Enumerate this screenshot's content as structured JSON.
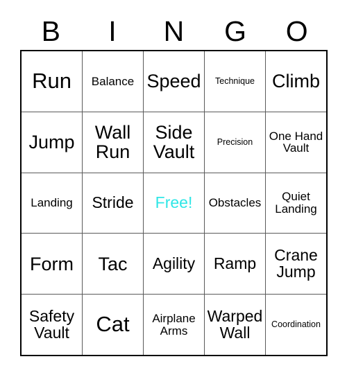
{
  "card": {
    "header_letters": [
      "B",
      "I",
      "N",
      "G",
      "O"
    ],
    "free_space_color": "#2fe6e6",
    "text_color": "#000000",
    "border_color": "#000000",
    "gridline_color": "#5a5a5a",
    "rows": [
      [
        {
          "text": "Run",
          "size": "sz-xl",
          "free": false
        },
        {
          "text": "Balance",
          "size": "sz-sm",
          "free": false
        },
        {
          "text": "Speed",
          "size": "sz-lg",
          "free": false
        },
        {
          "text": "Technique",
          "size": "sz-xs",
          "free": false
        },
        {
          "text": "Climb",
          "size": "sz-lg",
          "free": false
        }
      ],
      [
        {
          "text": "Jump",
          "size": "sz-lg",
          "free": false
        },
        {
          "text": "Wall Run",
          "size": "sz-lg",
          "free": false
        },
        {
          "text": "Side Vault",
          "size": "sz-lg",
          "free": false
        },
        {
          "text": "Precision",
          "size": "sz-xs",
          "free": false
        },
        {
          "text": "One Hand Vault",
          "size": "sz-sm",
          "free": false
        }
      ],
      [
        {
          "text": "Landing",
          "size": "sz-sm",
          "free": false
        },
        {
          "text": "Stride",
          "size": "sz-md",
          "free": false
        },
        {
          "text": "Free!",
          "size": "sz-md",
          "free": true
        },
        {
          "text": "Obstacles",
          "size": "sz-sm",
          "free": false
        },
        {
          "text": "Quiet Landing",
          "size": "sz-sm",
          "free": false
        }
      ],
      [
        {
          "text": "Form",
          "size": "sz-lg",
          "free": false
        },
        {
          "text": "Tac",
          "size": "sz-lg",
          "free": false
        },
        {
          "text": "Agility",
          "size": "sz-md",
          "free": false
        },
        {
          "text": "Ramp",
          "size": "sz-md",
          "free": false
        },
        {
          "text": "Crane Jump",
          "size": "sz-md",
          "free": false
        }
      ],
      [
        {
          "text": "Safety Vault",
          "size": "sz-md",
          "free": false
        },
        {
          "text": "Cat",
          "size": "sz-xl",
          "free": false
        },
        {
          "text": "Airplane Arms",
          "size": "sz-sm",
          "free": false
        },
        {
          "text": "Warped Wall",
          "size": "sz-md",
          "free": false
        },
        {
          "text": "Coordination",
          "size": "sz-xs",
          "free": false
        }
      ]
    ]
  }
}
